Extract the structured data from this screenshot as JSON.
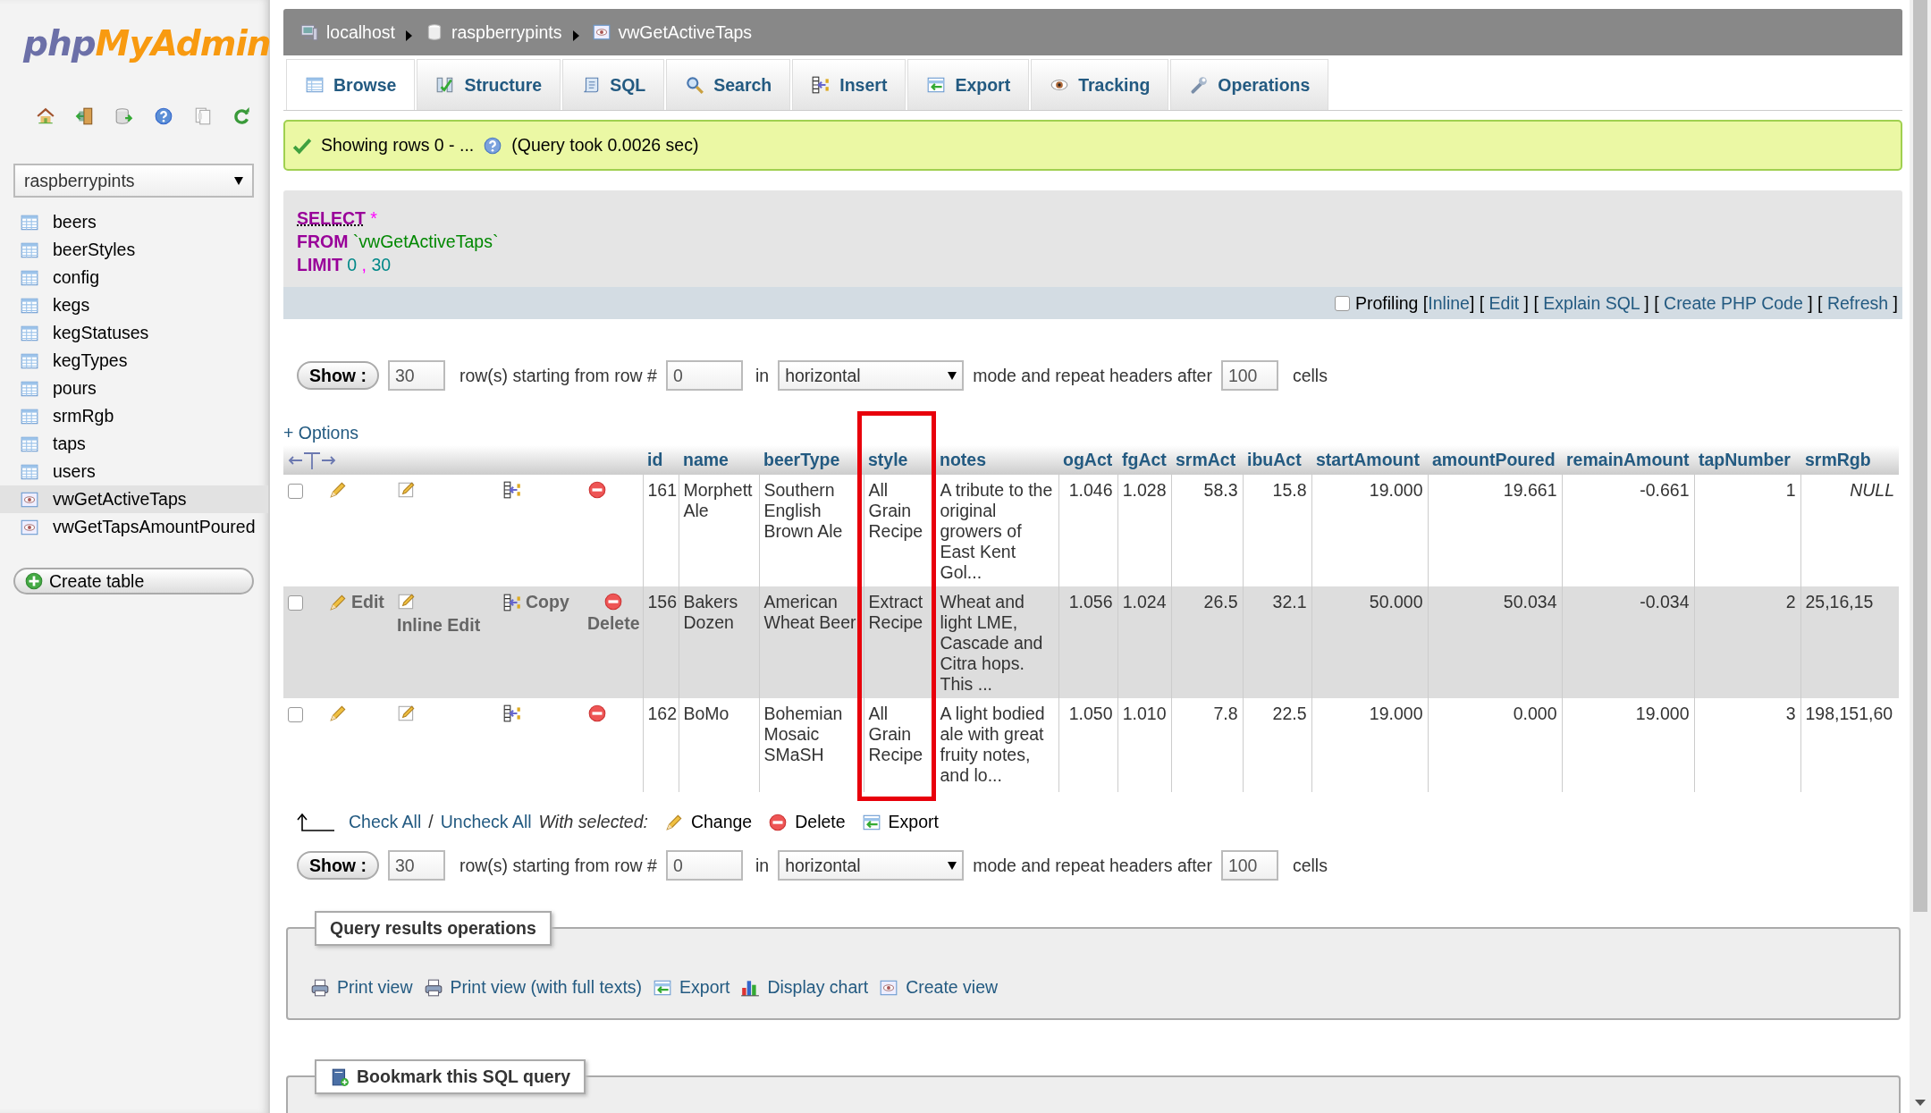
{
  "logo": {
    "part_1": "php",
    "part_2": "MyAdmin"
  },
  "navigation": {
    "database": "raspberrypints",
    "tables": [
      {
        "name": "beers",
        "kind": "table",
        "selected": false
      },
      {
        "name": "beerStyles",
        "kind": "table",
        "selected": false
      },
      {
        "name": "config",
        "kind": "table",
        "selected": false
      },
      {
        "name": "kegs",
        "kind": "table",
        "selected": false
      },
      {
        "name": "kegStatuses",
        "kind": "table",
        "selected": false
      },
      {
        "name": "kegTypes",
        "kind": "table",
        "selected": false
      },
      {
        "name": "pours",
        "kind": "table",
        "selected": false
      },
      {
        "name": "srmRgb",
        "kind": "table",
        "selected": false
      },
      {
        "name": "taps",
        "kind": "table",
        "selected": false
      },
      {
        "name": "users",
        "kind": "table",
        "selected": false
      },
      {
        "name": "vwGetActiveTaps",
        "kind": "view",
        "selected": true
      },
      {
        "name": "vwGetTapsAmountPoured",
        "kind": "view",
        "selected": false
      }
    ],
    "create_button": "Create table"
  },
  "breadcrumb": [
    "localhost",
    "raspberrypints",
    "vwGetActiveTaps"
  ],
  "tabs": [
    {
      "label": "Browse",
      "selected": true
    },
    {
      "label": "Structure",
      "selected": false
    },
    {
      "label": "SQL",
      "selected": false
    },
    {
      "label": "Search",
      "selected": false
    },
    {
      "label": "Insert",
      "selected": false
    },
    {
      "label": "Export",
      "selected": false
    },
    {
      "label": "Tracking",
      "selected": false
    },
    {
      "label": "Operations",
      "selected": false
    }
  ],
  "message": {
    "text": "Showing rows 0 - ...",
    "query_time": "(Query took 0.0026 sec)"
  },
  "sql": [
    [
      {
        "kind": "keyword",
        "text": "SELECT"
      },
      {
        "kind": "operator",
        "text": "*"
      }
    ],
    [
      {
        "kind": "keyword",
        "text": "FROM"
      },
      {
        "kind": "identifier",
        "text": "`vwGetActiveTaps`"
      }
    ],
    [
      {
        "kind": "keyword",
        "text": "LIMIT"
      },
      {
        "kind": "number",
        "text": "0"
      },
      {
        "kind": "operator",
        "text": ","
      },
      {
        "kind": "number",
        "text": "30"
      }
    ]
  ],
  "profiling": {
    "checked": false,
    "parts": [
      {
        "kind": "text",
        "text": "Profiling ["
      },
      {
        "kind": "link",
        "text": "Inline"
      },
      {
        "kind": "text",
        "text": "] [ "
      },
      {
        "kind": "link",
        "text": "Edit"
      },
      {
        "kind": "text",
        "text": " ] [ "
      },
      {
        "kind": "link",
        "text": "Explain SQL"
      },
      {
        "kind": "text",
        "text": " ] [ "
      },
      {
        "kind": "link",
        "text": "Create PHP Code"
      },
      {
        "kind": "text",
        "text": " ] [ "
      },
      {
        "kind": "link",
        "text": "Refresh"
      },
      {
        "kind": "text",
        "text": " ]"
      }
    ]
  },
  "pagers": [
    {
      "show_button": "Show :",
      "rows": "30",
      "rows_label": "row(s) starting from row #",
      "start": "0",
      "in_label": "in",
      "mode": "horizontal",
      "mode_label": "mode and repeat headers after",
      "repeat": "100",
      "cells_label": "cells"
    },
    {
      "show_button": "Show :",
      "rows": "30",
      "rows_label": "row(s) starting from row #",
      "start": "0",
      "in_label": "in",
      "mode": "horizontal",
      "mode_label": "mode and repeat headers after",
      "repeat": "100",
      "cells_label": "cells"
    }
  ],
  "options_link": "+ Options",
  "table": {
    "columns": [
      "id",
      "name",
      "beerType",
      "style",
      "notes",
      "ogAct",
      "fgAct",
      "srmAct",
      "ibuAct",
      "startAmount",
      "amountPoured",
      "remainAmount",
      "tapNumber",
      "srmRgb"
    ],
    "rows": [
      {
        "checked": false,
        "highlighted": false,
        "cells": [
          "161",
          "Morphett Ale",
          "Southern English Brown Ale",
          "All Grain Recipe",
          "A tribute to the original growers of East Kent Gol...",
          "1.046",
          "1.028",
          "58.3",
          "15.8",
          "19.000",
          "19.661",
          "-0.661",
          "1",
          {
            "kind": "null",
            "text": "NULL"
          }
        ]
      },
      {
        "checked": false,
        "highlighted": true,
        "action_labels": [
          "Edit",
          "Inline Edit",
          "Copy",
          "Delete"
        ],
        "cells": [
          "156",
          "Bakers Dozen",
          "American Wheat Beer",
          "Extract Recipe",
          "Wheat and light LME, Cascade and Citra hops. This ...",
          "1.056",
          "1.024",
          "26.5",
          "32.1",
          "50.000",
          "50.034",
          "-0.034",
          "2",
          "25,16,15"
        ]
      },
      {
        "checked": false,
        "highlighted": false,
        "cells": [
          "162",
          "BoMo",
          "Bohemian Mosaic SMaSH",
          "All Grain Recipe",
          "A light bodied ale with great fruity notes, and lo...",
          "1.050",
          "1.010",
          "7.8",
          "22.5",
          "19.000",
          "0.000",
          "19.000",
          "3",
          "198,151,60"
        ]
      }
    ]
  },
  "bulk": {
    "check_all": "Check All",
    "separator": "/",
    "uncheck_all": "Uncheck All",
    "with_selected": "With selected:",
    "actions": [
      "Change",
      "Delete",
      "Export"
    ]
  },
  "operations": {
    "legend": "Query results operations",
    "links": [
      "Print view",
      "Print view (with full texts)",
      "Export",
      "Display chart",
      "Create view"
    ]
  },
  "bookmark": {
    "legend": "Bookmark this SQL query"
  },
  "annotation": {
    "kind": "frame",
    "color": "#e8000b"
  }
}
